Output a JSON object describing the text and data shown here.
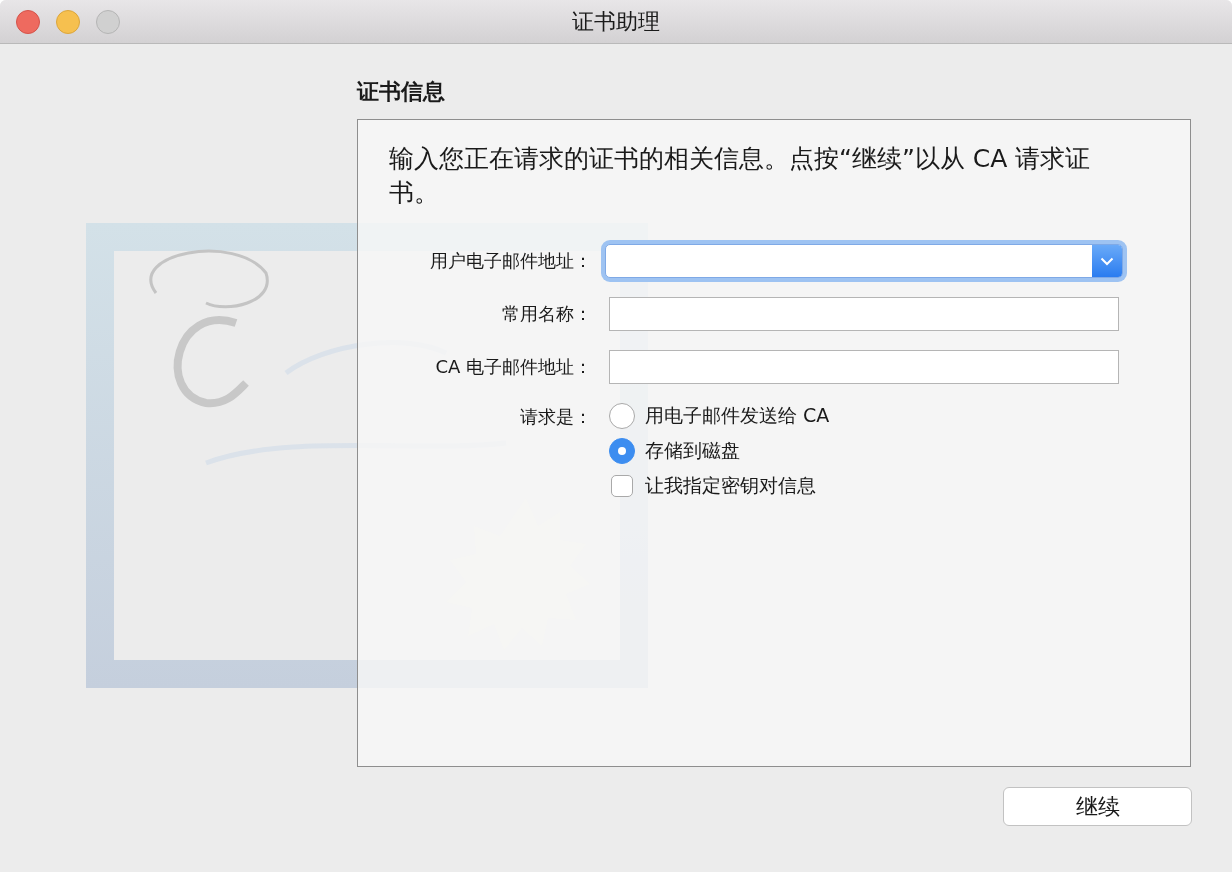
{
  "window": {
    "title": "证书助理"
  },
  "section_title": "证书信息",
  "description": "输入您正在请求的证书的相关信息。点按“继续”以从 CA 请求证书。",
  "fields": [
    {
      "label": "用户电子邮件地址：",
      "kind": "combo",
      "focused": true
    },
    {
      "label": "常用名称：",
      "kind": "text",
      "focused": false
    },
    {
      "label": "CA 电子邮件地址：",
      "kind": "text",
      "focused": false
    }
  ],
  "request": {
    "label": "请求是：",
    "options": [
      {
        "kind": "radio",
        "label": "用电子邮件发送给 CA",
        "selected": false
      },
      {
        "kind": "radio",
        "label": "存储到磁盘",
        "selected": true
      },
      {
        "kind": "checkbox",
        "label": "让我指定密钥对信息",
        "checked": false
      }
    ]
  },
  "buttons": [
    {
      "label": "继续"
    }
  ]
}
